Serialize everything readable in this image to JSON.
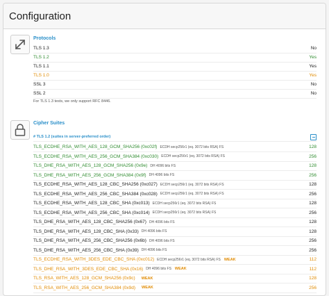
{
  "header": {
    "title": "Configuration"
  },
  "protocols": {
    "title": "Protocols",
    "icon": "arrows-expand-icon",
    "rows": [
      {
        "name": "TLS 1.3",
        "value": "No",
        "color": ""
      },
      {
        "name": "TLS 1.2",
        "value": "Yes",
        "color": "green"
      },
      {
        "name": "TLS 1.1",
        "value": "Yes",
        "color": ""
      },
      {
        "name": "TLS 1.0",
        "value": "Yes",
        "color": "orange"
      },
      {
        "name": "SSL 3",
        "value": "No",
        "color": ""
      },
      {
        "name": "SSL 2",
        "value": "No",
        "color": ""
      }
    ],
    "note": "For TLS 1.3 tests, we only support RFC 8446."
  },
  "ciphers": {
    "title": "Cipher Suites",
    "icon": "padlock-icon",
    "subheader": "# TLS 1.2 (suites in server-preferred order)",
    "rows": [
      {
        "name": "TLS_ECDHE_RSA_WITH_AES_128_GCM_SHA256 (0xc02f)",
        "meta": "ECDH secp256r1 (eq. 3072 bits RSA)   FS",
        "value": "128",
        "color": "green",
        "weak": ""
      },
      {
        "name": "TLS_ECDHE_RSA_WITH_AES_256_GCM_SHA384 (0xc030)",
        "meta": "ECDH secp256r1 (eq. 3072 bits RSA)   FS",
        "value": "256",
        "color": "green",
        "weak": ""
      },
      {
        "name": "TLS_DHE_RSA_WITH_AES_128_GCM_SHA256 (0x9e)",
        "meta": "DH 4096 bits   FS",
        "value": "128",
        "color": "green",
        "weak": ""
      },
      {
        "name": "TLS_DHE_RSA_WITH_AES_256_GCM_SHA384 (0x9f)",
        "meta": "DH 4096 bits   FS",
        "value": "256",
        "color": "green",
        "weak": ""
      },
      {
        "name": "TLS_ECDHE_RSA_WITH_AES_128_CBC_SHA256 (0xc027)",
        "meta": "ECDH secp256r1 (eq. 3072 bits RSA)   FS",
        "value": "128",
        "color": "",
        "weak": ""
      },
      {
        "name": "TLS_ECDHE_RSA_WITH_AES_256_CBC_SHA384 (0xc028)",
        "meta": "ECDH secp256r1 (eq. 3072 bits RSA)   FS",
        "value": "256",
        "color": "",
        "weak": ""
      },
      {
        "name": "TLS_ECDHE_RSA_WITH_AES_128_CBC_SHA (0xc013)",
        "meta": "ECDH secp256r1 (eq. 3072 bits RSA)   FS",
        "value": "128",
        "color": "",
        "weak": ""
      },
      {
        "name": "TLS_ECDHE_RSA_WITH_AES_256_CBC_SHA (0xc014)",
        "meta": "ECDH secp256r1 (eq. 3072 bits RSA)   FS",
        "value": "256",
        "color": "",
        "weak": ""
      },
      {
        "name": "TLS_DHE_RSA_WITH_AES_128_CBC_SHA256 (0x67)",
        "meta": "DH 4096 bits   FS",
        "value": "128",
        "color": "",
        "weak": ""
      },
      {
        "name": "TLS_DHE_RSA_WITH_AES_128_CBC_SHA (0x33)",
        "meta": "DH 4096 bits   FS",
        "value": "128",
        "color": "",
        "weak": ""
      },
      {
        "name": "TLS_DHE_RSA_WITH_AES_256_CBC_SHA256 (0x6b)",
        "meta": "DH 4096 bits   FS",
        "value": "256",
        "color": "",
        "weak": ""
      },
      {
        "name": "TLS_DHE_RSA_WITH_AES_256_CBC_SHA (0x39)",
        "meta": "DH 4096 bits   FS",
        "value": "256",
        "color": "",
        "weak": ""
      },
      {
        "name": "TLS_ECDHE_RSA_WITH_3DES_EDE_CBC_SHA (0xc012)",
        "meta": "ECDH secp256r1 (eq. 3072 bits RSA)   FS",
        "value": "112",
        "color": "orange",
        "weak": "WEAK"
      },
      {
        "name": "TLS_DHE_RSA_WITH_3DES_EDE_CBC_SHA (0x16)",
        "meta": "DH 4096 bits   FS",
        "value": "112",
        "color": "orange",
        "weak": "WEAK"
      },
      {
        "name": "TLS_RSA_WITH_AES_128_GCM_SHA256 (0x9c)",
        "meta": "",
        "value": "128",
        "color": "orange",
        "weak": "WEAK"
      },
      {
        "name": "TLS_RSA_WITH_AES_256_GCM_SHA384 (0x9d)",
        "meta": "",
        "value": "256",
        "color": "orange",
        "weak": "WEAK"
      }
    ]
  }
}
